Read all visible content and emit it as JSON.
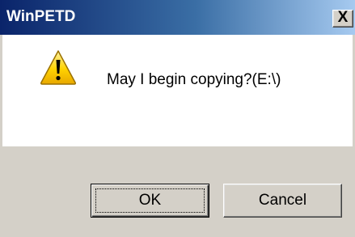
{
  "window": {
    "title": "WinPETD",
    "close_label": "X"
  },
  "message": {
    "icon": "warning-icon",
    "text": "May I begin copying?(E:\\)"
  },
  "buttons": {
    "ok_label": "OK",
    "cancel_label": "Cancel"
  },
  "colors": {
    "titlebar_start": "#0a246a",
    "titlebar_end": "#a6caf0",
    "dialog_face": "#d4d0c8",
    "content_background": "#ffffff",
    "warning_yellow": "#ffd200"
  }
}
